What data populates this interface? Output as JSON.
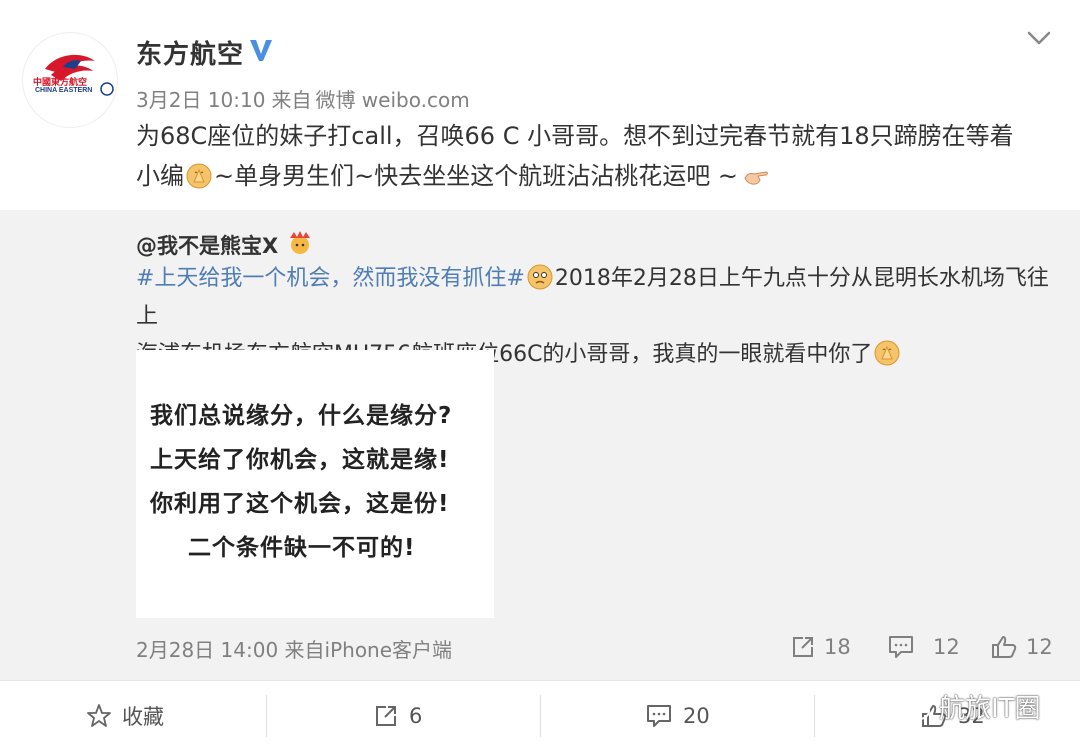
{
  "post": {
    "author": "东方航空",
    "logo_text": "中國東方航空",
    "logo_subtext": "CHINA EASTERN",
    "date": "3月2日 10:10",
    "source_prefix": "来自",
    "source": "微博 weibo.com",
    "text_line1": "为68C座位的妹子打call，召唤66 C 小哥哥。想不到过完春节就有18只蹄膀在等着",
    "text_line2_a": "小编",
    "text_line2_b": "~单身男生们~快去坐坐这个航班沾沾桃花运吧 ~",
    "icons": [
      "china-eastern-logo-icon",
      "verified-v-icon",
      "chevron-down-icon",
      "pray-emoji-icon",
      "point-hand-emoji-icon"
    ]
  },
  "repost": {
    "author": "@我不是熊宝X",
    "topic": "#上天给我一个机会，然而我没有抓住#",
    "text_a": "2018年2月28日上午九点十分从昆明长水机场飞往上",
    "text_b": "海浦东机场东方航空MU756航班座位66C的小哥哥，我真的一眼就看中你了",
    "image_lines": [
      "我们总说缘分，什么是缘分?",
      "上天给了你机会，这就是缘!",
      "你利用了这个机会，这是份!",
      "二个条件缺一不可的!"
    ],
    "date": "2月28日 14:00",
    "source_prefix": "来自",
    "source": "iPhone客户端",
    "reposts": "18",
    "comments": "12",
    "likes": "12"
  },
  "footer": {
    "favorite_label": "收藏",
    "reposts": "6",
    "comments": "20",
    "likes": "32",
    "watermark": "航旅IT圈"
  },
  "colors": {
    "topic": "#4f7db6",
    "verified": "#4a90e2",
    "repost_bg": "#f2f2f2",
    "logo_red": "#d7182a",
    "logo_blue": "#1b3f8a"
  }
}
